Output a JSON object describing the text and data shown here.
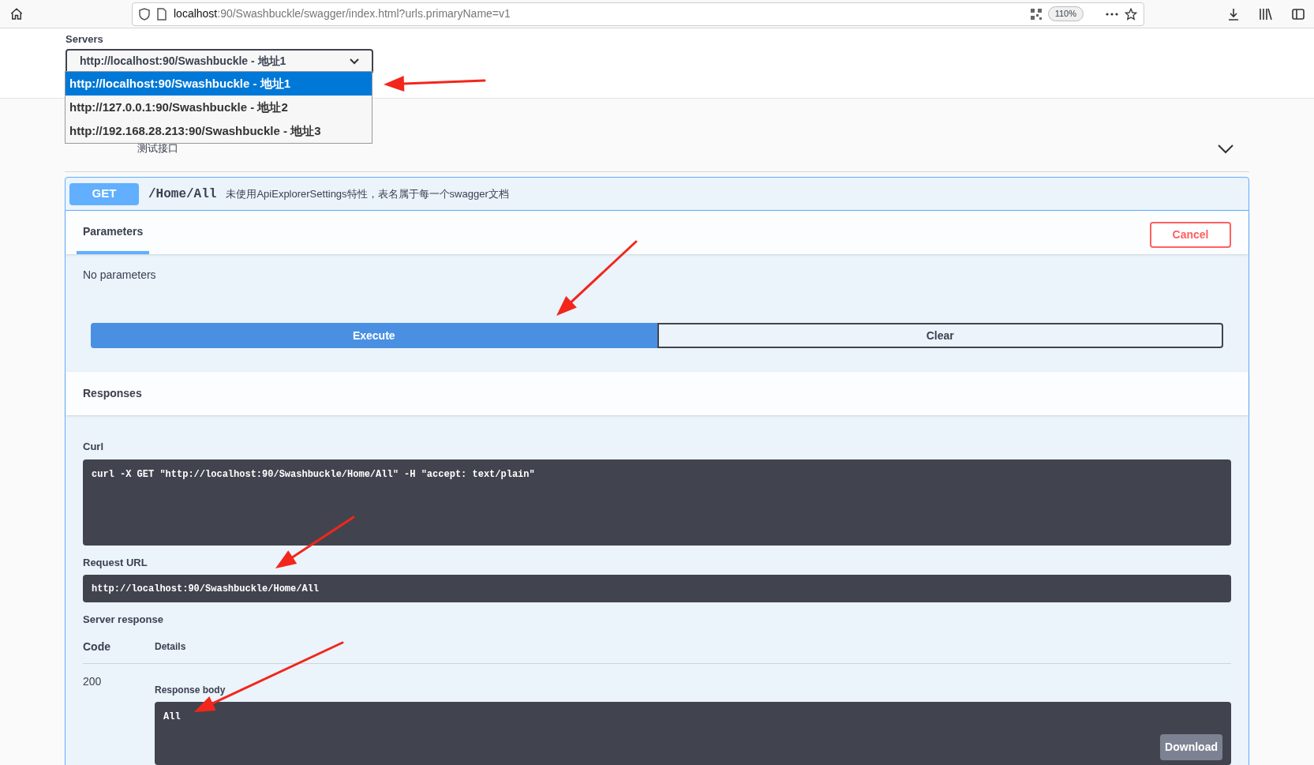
{
  "browser": {
    "url_host": "localhost",
    "url_rest": ":90/Swashbuckle/swagger/index.html?urls.primaryName=v1",
    "zoom": "110%"
  },
  "servers": {
    "label": "Servers",
    "value": "http://localhost:90/Swashbuckle - 地址1",
    "options": [
      {
        "label": "http://localhost:90/Swashbuckle - 地址1",
        "selected": true
      },
      {
        "label": "http://127.0.0.1:90/Swashbuckle - 地址2",
        "selected": false
      },
      {
        "label": "http://192.168.28.213:90/Swashbuckle - 地址3",
        "selected": false
      }
    ]
  },
  "section": {
    "description": "测试接口"
  },
  "operation": {
    "method": "GET",
    "path": "/Home/All",
    "summary": "未使用ApiExplorerSettings特性，表名属于每一个swagger文档",
    "parameters_tab": "Parameters",
    "cancel": "Cancel",
    "no_parameters": "No parameters",
    "execute": "Execute",
    "clear": "Clear",
    "responses_title": "Responses",
    "curl_label": "Curl",
    "curl": "curl -X GET \"http://localhost:90/Swashbuckle/Home/All\" -H \"accept: text/plain\"",
    "request_url_label": "Request URL",
    "request_url": "http://localhost:90/Swashbuckle/Home/All",
    "server_response_label": "Server response",
    "code_heading": "Code",
    "details_heading": "Details",
    "code": "200",
    "response_body_label": "Response body",
    "response_body": "All",
    "download": "Download"
  }
}
